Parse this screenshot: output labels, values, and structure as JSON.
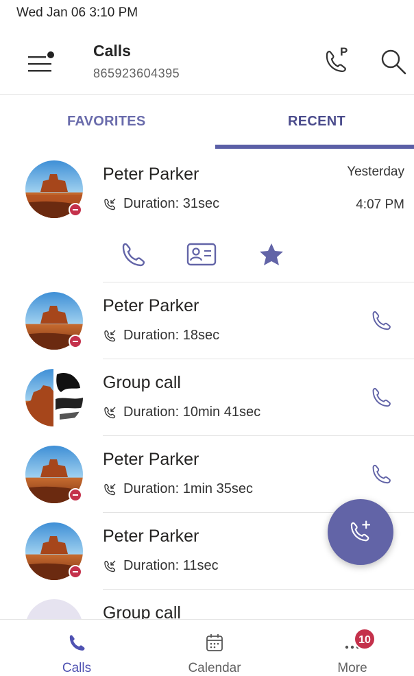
{
  "status_bar": {
    "datetime": "Wed Jan 06  3:10 PM"
  },
  "header": {
    "title": "Calls",
    "subtitle": "865923604395"
  },
  "tabs": [
    {
      "label": "FAVORITES",
      "selected": false
    },
    {
      "label": "RECENT",
      "selected": true
    }
  ],
  "recent_calls": [
    {
      "name": "Peter Parker",
      "detail": "Duration: 31sec",
      "date": "Yesterday",
      "time": "4:07 PM",
      "avatar": "desert-photo",
      "presence": "do-not-disturb",
      "expanded": true
    },
    {
      "name": "Peter Parker",
      "detail": "Duration: 18sec",
      "avatar": "desert-photo",
      "presence": "do-not-disturb"
    },
    {
      "name": "Group call",
      "detail": "Duration: 10min 41sec",
      "avatar": "group-split-photo"
    },
    {
      "name": "Peter Parker",
      "detail": "Duration: 1min 35sec",
      "avatar": "desert-photo",
      "presence": "do-not-disturb"
    },
    {
      "name": "Peter Parker",
      "detail": "Duration: 11sec",
      "avatar": "desert-photo",
      "presence": "do-not-disturb"
    },
    {
      "name": "Group call",
      "avatar": "placeholder-circle"
    }
  ],
  "expanded_actions": [
    "phone-icon",
    "contact-card-icon",
    "star-icon"
  ],
  "bottom_nav": [
    {
      "label": "Calls",
      "icon": "phone-icon",
      "selected": true
    },
    {
      "label": "Calendar",
      "icon": "calendar-icon"
    },
    {
      "label": "More",
      "icon": "more-icon",
      "badge": "10"
    }
  ],
  "colors": {
    "accent": "#6264a7",
    "tab_underline": "#5b5fa6",
    "presence_dnd": "#c4314b",
    "badge": "#c4314b"
  }
}
